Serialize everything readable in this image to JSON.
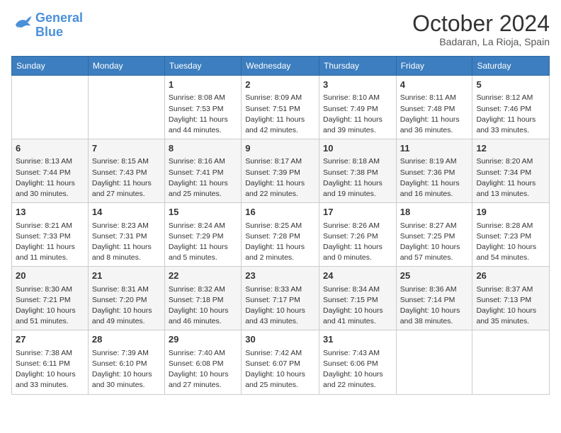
{
  "header": {
    "logo_line1": "General",
    "logo_line2": "Blue",
    "month_year": "October 2024",
    "location": "Badaran, La Rioja, Spain"
  },
  "days_of_week": [
    "Sunday",
    "Monday",
    "Tuesday",
    "Wednesday",
    "Thursday",
    "Friday",
    "Saturday"
  ],
  "weeks": [
    [
      {
        "day": "",
        "info": ""
      },
      {
        "day": "",
        "info": ""
      },
      {
        "day": "1",
        "info": "Sunrise: 8:08 AM\nSunset: 7:53 PM\nDaylight: 11 hours and 44 minutes."
      },
      {
        "day": "2",
        "info": "Sunrise: 8:09 AM\nSunset: 7:51 PM\nDaylight: 11 hours and 42 minutes."
      },
      {
        "day": "3",
        "info": "Sunrise: 8:10 AM\nSunset: 7:49 PM\nDaylight: 11 hours and 39 minutes."
      },
      {
        "day": "4",
        "info": "Sunrise: 8:11 AM\nSunset: 7:48 PM\nDaylight: 11 hours and 36 minutes."
      },
      {
        "day": "5",
        "info": "Sunrise: 8:12 AM\nSunset: 7:46 PM\nDaylight: 11 hours and 33 minutes."
      }
    ],
    [
      {
        "day": "6",
        "info": "Sunrise: 8:13 AM\nSunset: 7:44 PM\nDaylight: 11 hours and 30 minutes."
      },
      {
        "day": "7",
        "info": "Sunrise: 8:15 AM\nSunset: 7:43 PM\nDaylight: 11 hours and 27 minutes."
      },
      {
        "day": "8",
        "info": "Sunrise: 8:16 AM\nSunset: 7:41 PM\nDaylight: 11 hours and 25 minutes."
      },
      {
        "day": "9",
        "info": "Sunrise: 8:17 AM\nSunset: 7:39 PM\nDaylight: 11 hours and 22 minutes."
      },
      {
        "day": "10",
        "info": "Sunrise: 8:18 AM\nSunset: 7:38 PM\nDaylight: 11 hours and 19 minutes."
      },
      {
        "day": "11",
        "info": "Sunrise: 8:19 AM\nSunset: 7:36 PM\nDaylight: 11 hours and 16 minutes."
      },
      {
        "day": "12",
        "info": "Sunrise: 8:20 AM\nSunset: 7:34 PM\nDaylight: 11 hours and 13 minutes."
      }
    ],
    [
      {
        "day": "13",
        "info": "Sunrise: 8:21 AM\nSunset: 7:33 PM\nDaylight: 11 hours and 11 minutes."
      },
      {
        "day": "14",
        "info": "Sunrise: 8:23 AM\nSunset: 7:31 PM\nDaylight: 11 hours and 8 minutes."
      },
      {
        "day": "15",
        "info": "Sunrise: 8:24 AM\nSunset: 7:29 PM\nDaylight: 11 hours and 5 minutes."
      },
      {
        "day": "16",
        "info": "Sunrise: 8:25 AM\nSunset: 7:28 PM\nDaylight: 11 hours and 2 minutes."
      },
      {
        "day": "17",
        "info": "Sunrise: 8:26 AM\nSunset: 7:26 PM\nDaylight: 11 hours and 0 minutes."
      },
      {
        "day": "18",
        "info": "Sunrise: 8:27 AM\nSunset: 7:25 PM\nDaylight: 10 hours and 57 minutes."
      },
      {
        "day": "19",
        "info": "Sunrise: 8:28 AM\nSunset: 7:23 PM\nDaylight: 10 hours and 54 minutes."
      }
    ],
    [
      {
        "day": "20",
        "info": "Sunrise: 8:30 AM\nSunset: 7:21 PM\nDaylight: 10 hours and 51 minutes."
      },
      {
        "day": "21",
        "info": "Sunrise: 8:31 AM\nSunset: 7:20 PM\nDaylight: 10 hours and 49 minutes."
      },
      {
        "day": "22",
        "info": "Sunrise: 8:32 AM\nSunset: 7:18 PM\nDaylight: 10 hours and 46 minutes."
      },
      {
        "day": "23",
        "info": "Sunrise: 8:33 AM\nSunset: 7:17 PM\nDaylight: 10 hours and 43 minutes."
      },
      {
        "day": "24",
        "info": "Sunrise: 8:34 AM\nSunset: 7:15 PM\nDaylight: 10 hours and 41 minutes."
      },
      {
        "day": "25",
        "info": "Sunrise: 8:36 AM\nSunset: 7:14 PM\nDaylight: 10 hours and 38 minutes."
      },
      {
        "day": "26",
        "info": "Sunrise: 8:37 AM\nSunset: 7:13 PM\nDaylight: 10 hours and 35 minutes."
      }
    ],
    [
      {
        "day": "27",
        "info": "Sunrise: 7:38 AM\nSunset: 6:11 PM\nDaylight: 10 hours and 33 minutes."
      },
      {
        "day": "28",
        "info": "Sunrise: 7:39 AM\nSunset: 6:10 PM\nDaylight: 10 hours and 30 minutes."
      },
      {
        "day": "29",
        "info": "Sunrise: 7:40 AM\nSunset: 6:08 PM\nDaylight: 10 hours and 27 minutes."
      },
      {
        "day": "30",
        "info": "Sunrise: 7:42 AM\nSunset: 6:07 PM\nDaylight: 10 hours and 25 minutes."
      },
      {
        "day": "31",
        "info": "Sunrise: 7:43 AM\nSunset: 6:06 PM\nDaylight: 10 hours and 22 minutes."
      },
      {
        "day": "",
        "info": ""
      },
      {
        "day": "",
        "info": ""
      }
    ]
  ]
}
